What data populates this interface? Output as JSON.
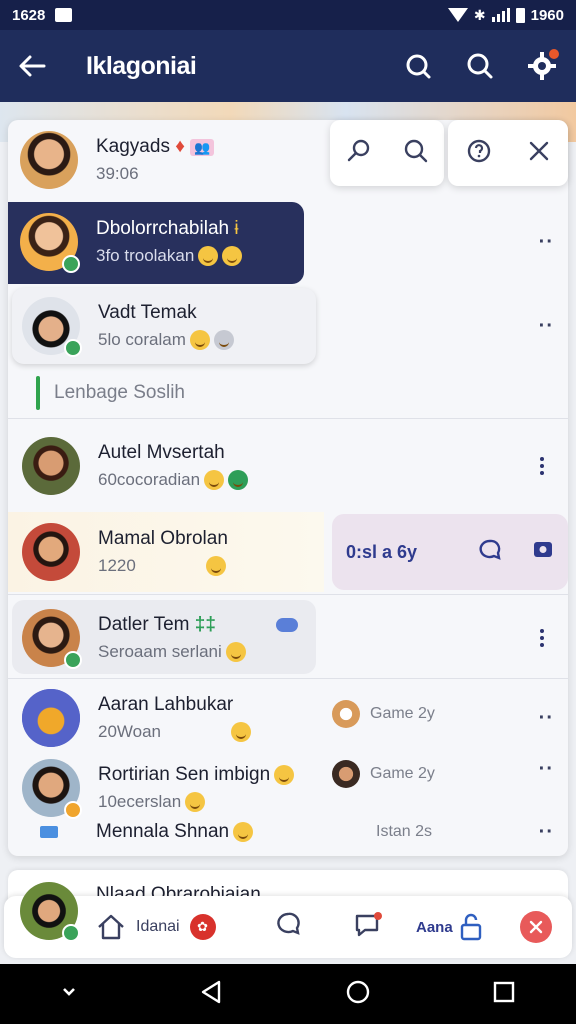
{
  "status_bar": {
    "time": "1628",
    "right_text": "1960"
  },
  "app_bar": {
    "title": "Iklagoniai"
  },
  "popover": {
    "icons": [
      "pin-icon",
      "search-icon",
      "help-icon",
      "close-icon"
    ]
  },
  "chats": [
    {
      "name": "Kagyads",
      "tag": "👥",
      "sub": "39:06"
    },
    {
      "name": "Dbolorrchabilah",
      "sub": "3fo troolakan"
    },
    {
      "name": "Vadt Temak",
      "sub": "5lo coralam"
    },
    {
      "name": "Autel Mvsertah",
      "sub": "60cocoradian"
    },
    {
      "name": "Mamal Obrolan",
      "sub": "1220"
    },
    {
      "name": "Datler Tem",
      "sub": "Seroaam serlani"
    },
    {
      "name": "Aaran Lahbukar",
      "sub": "20Woan",
      "game": "Game 2y"
    },
    {
      "name": "Rortirian Sen imbign",
      "sub": "10ecerslan",
      "game": "Game 2y"
    },
    {
      "name": "Mennala Shnan",
      "meta": "Istan 2s"
    }
  ],
  "section": {
    "label": "Lenbage Soslih"
  },
  "action_panel": {
    "last_seen": "0:sl a 6y"
  },
  "peek": {
    "name": "Nlaad Obrarobiaian"
  },
  "bottom_nav": {
    "label1": "Idanai",
    "label2": "Aana"
  },
  "colors": {
    "appbar": "#1f2d5c",
    "selected": "#28305d",
    "accent": "#2fa34d"
  }
}
